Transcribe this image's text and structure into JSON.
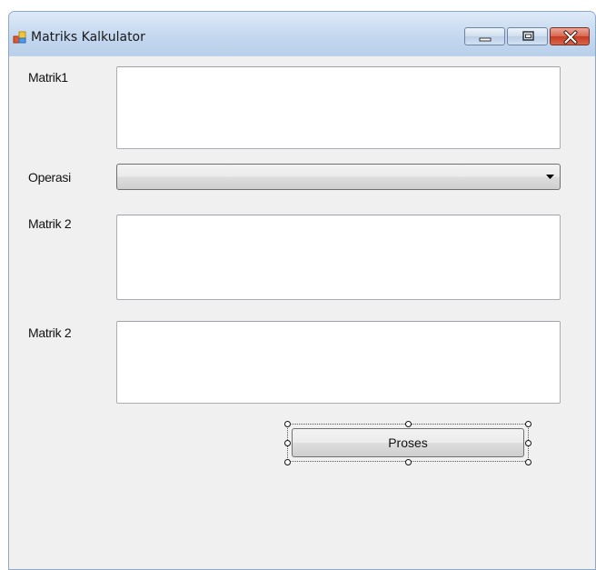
{
  "window": {
    "title": "Matriks Kalkulator",
    "icon": "winforms-form-icon",
    "caption_buttons": [
      "minimize-icon",
      "maximize-icon",
      "close-icon"
    ]
  },
  "form": {
    "label_matrix1": "Matrik1",
    "label_operation": "Operasi",
    "label_matrix2": "Matrik 2",
    "label_result": "Matrik 2",
    "matrix1_value": "",
    "operation_selected": "",
    "matrix2_value": "",
    "result_value": "",
    "process_button": "Proses"
  },
  "colors": {
    "client_background": "#f0f0f0",
    "titlebar": "#c4d8ef",
    "close_button": "#c43b21"
  }
}
